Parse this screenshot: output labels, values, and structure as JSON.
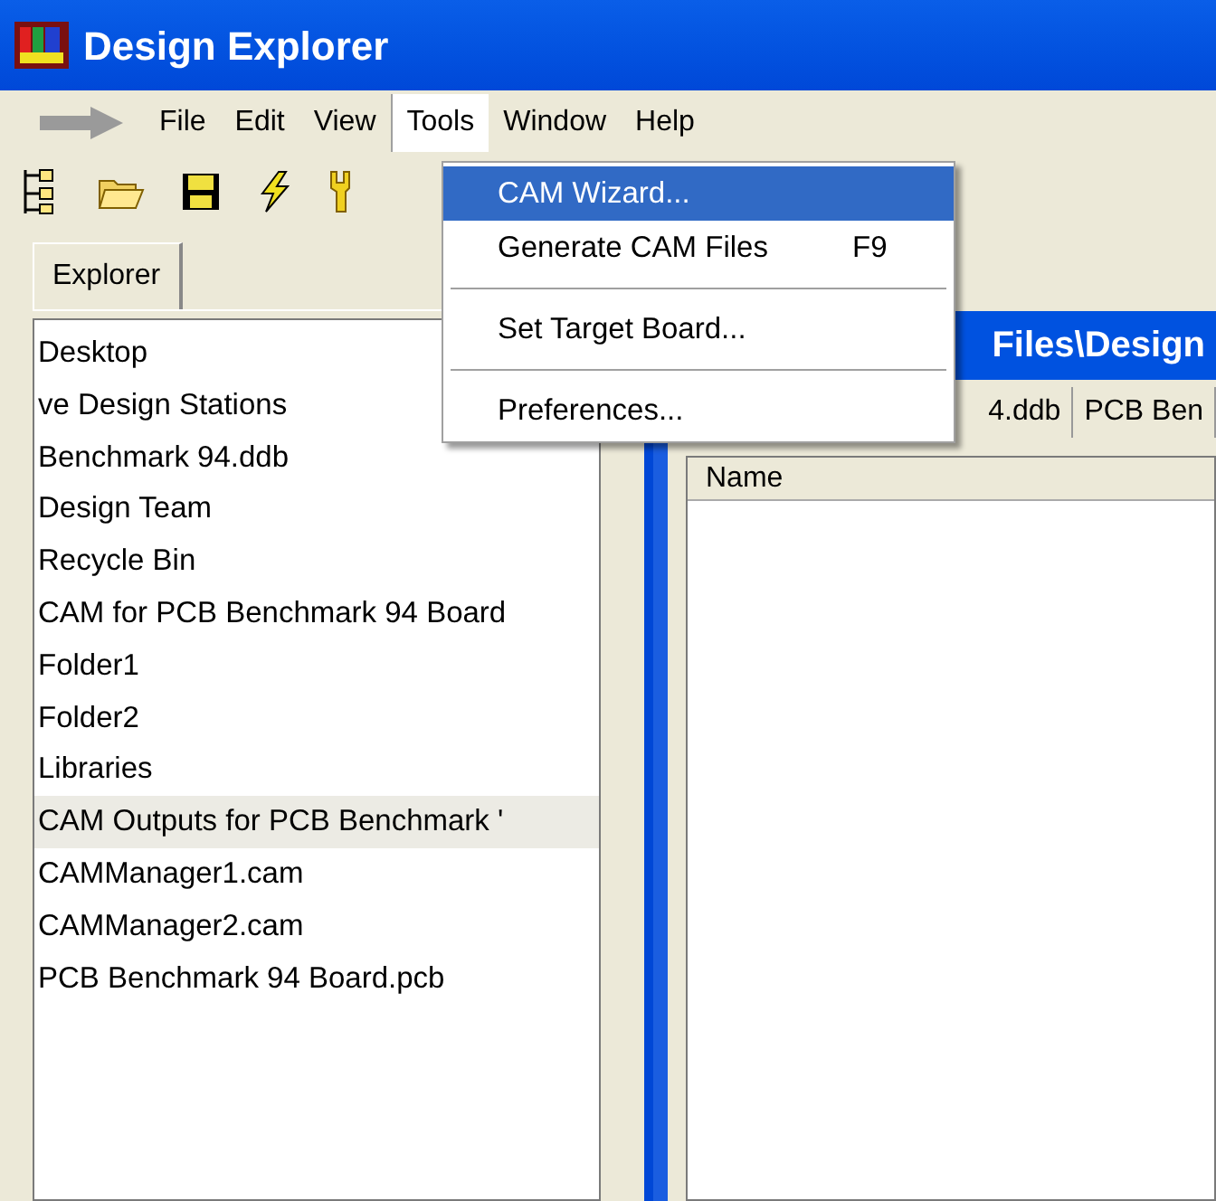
{
  "window": {
    "title": "Design Explorer"
  },
  "menu_bar": [
    {
      "label": "File",
      "selected": false
    },
    {
      "label": "Edit",
      "selected": false
    },
    {
      "label": "View",
      "selected": false
    },
    {
      "label": "Tools",
      "selected": true
    },
    {
      "label": "Window",
      "selected": false
    },
    {
      "label": "Help",
      "selected": false
    }
  ],
  "tools_menu": [
    {
      "kind": "item",
      "label": "CAM Wizard...",
      "selected": true
    },
    {
      "kind": "item",
      "label": "Generate CAM Files",
      "shortcut": "F9",
      "selected": false
    },
    {
      "kind": "separator"
    },
    {
      "kind": "item",
      "label": "Set Target Board...",
      "selected": false
    },
    {
      "kind": "separator"
    },
    {
      "kind": "item",
      "label": "Preferences...",
      "selected": false
    }
  ],
  "explorer": {
    "tab": "Explorer",
    "items": [
      {
        "label": "Desktop",
        "selected": false
      },
      {
        "label": "ve Design Stations",
        "selected": false
      },
      {
        "label": "Benchmark 94.ddb",
        "selected": false
      },
      {
        "label": "Design Team",
        "selected": false
      },
      {
        "label": "Recycle Bin",
        "selected": false
      },
      {
        "label": "CAM for PCB Benchmark 94 Board",
        "selected": false
      },
      {
        "label": "Folder1",
        "selected": false
      },
      {
        "label": "Folder2",
        "selected": false
      },
      {
        "label": "Libraries",
        "selected": false
      },
      {
        "label": "CAM Outputs for PCB Benchmark '",
        "selected": true
      },
      {
        "label": "CAMManager1.cam",
        "selected": false
      },
      {
        "label": "CAMManager2.cam",
        "selected": false
      },
      {
        "label": "PCB Benchmark 94 Board.pcb",
        "selected": false
      }
    ]
  },
  "document": {
    "title": "Files\\Design",
    "tabs": [
      {
        "label": "4.ddb",
        "selected": false
      },
      {
        "label": "PCB Ben",
        "selected": false
      }
    ],
    "columns": [
      "Name"
    ]
  }
}
